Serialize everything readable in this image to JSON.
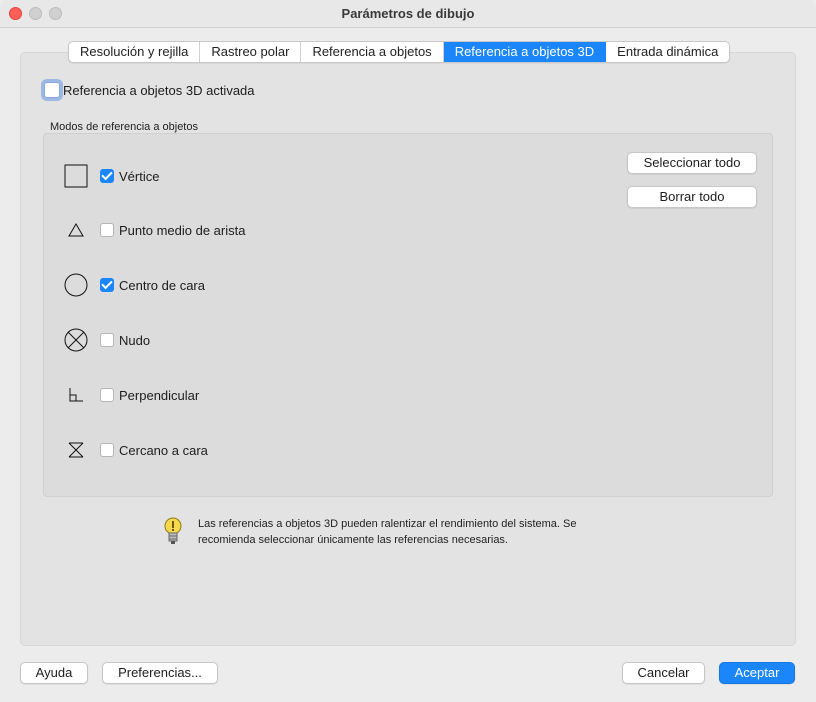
{
  "window": {
    "title": "Parámetros de dibujo"
  },
  "tabs": [
    {
      "label": "Resolución y rejilla",
      "active": false
    },
    {
      "label": "Rastreo polar",
      "active": false
    },
    {
      "label": "Referencia a objetos",
      "active": false
    },
    {
      "label": "Referencia a objetos 3D",
      "active": true
    },
    {
      "label": "Entrada dinámica",
      "active": false
    }
  ],
  "enable": {
    "label": "Referencia a objetos 3D activada",
    "checked": false
  },
  "group": {
    "label": "Modos de referencia a objetos"
  },
  "modes": [
    {
      "label": "Vértice",
      "icon": "square-icon",
      "checked": true
    },
    {
      "label": "Punto medio de arista",
      "icon": "triangle-icon",
      "checked": false
    },
    {
      "label": "Centro de cara",
      "icon": "circle-icon",
      "checked": true
    },
    {
      "label": "Nudo",
      "icon": "circle-x-icon",
      "checked": false
    },
    {
      "label": "Perpendicular",
      "icon": "perpendicular-icon",
      "checked": false
    },
    {
      "label": "Cercano a cara",
      "icon": "hourglass-icon",
      "checked": false
    }
  ],
  "buttons": {
    "select_all": "Seleccionar todo",
    "clear_all": "Borrar todo",
    "help": "Ayuda",
    "preferences": "Preferencias...",
    "cancel": "Cancelar",
    "accept": "Aceptar"
  },
  "hint": {
    "icon": "lightbulb-icon",
    "text": "Las referencias a objetos 3D pueden ralentizar el rendimiento del sistema. Se recomienda seleccionar únicamente las referencias necesarias."
  },
  "colors": {
    "accent": "#1a86f9",
    "close": "#fe5f57"
  }
}
